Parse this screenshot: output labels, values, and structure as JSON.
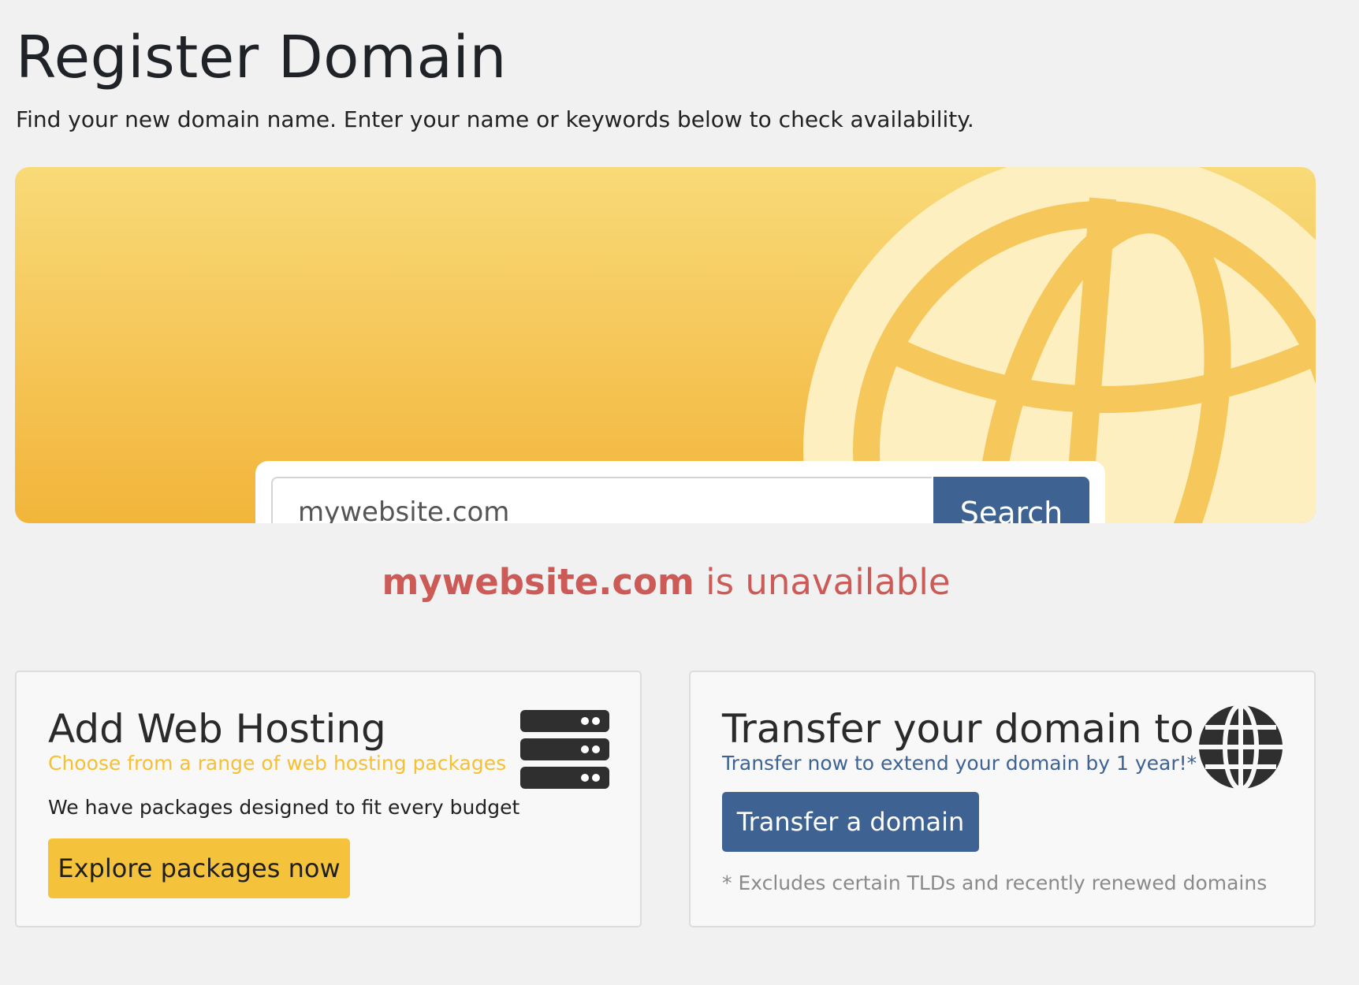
{
  "header": {
    "title": "Register Domain",
    "subtitle": "Find your new domain name. Enter your name or keywords below to check availability."
  },
  "search": {
    "value": "mywebsite.com",
    "placeholder": "",
    "button_label": "Search"
  },
  "result": {
    "domain": "mywebsite.com",
    "status_text": " is unavailable",
    "color": "#cc5a57"
  },
  "hosting_card": {
    "title": "Add Web Hosting",
    "tagline": "Choose from a range of web hosting packages",
    "description": "We have packages designed to fit every budget",
    "button_label": "Explore packages now",
    "icon": "server-icon"
  },
  "transfer_card": {
    "title": "Transfer your domain to us",
    "tagline": "Transfer now to extend your domain by 1 year!*",
    "button_label": "Transfer a domain",
    "footnote": "* Excludes certain TLDs and recently renewed domains",
    "icon": "globe-icon"
  },
  "colors": {
    "page_background": "#f1f1f1",
    "banner_yellow": "#f5c353",
    "primary_blue": "#3e6393",
    "accent_yellow": "#f5c33b",
    "error_red": "#cc5a57"
  }
}
